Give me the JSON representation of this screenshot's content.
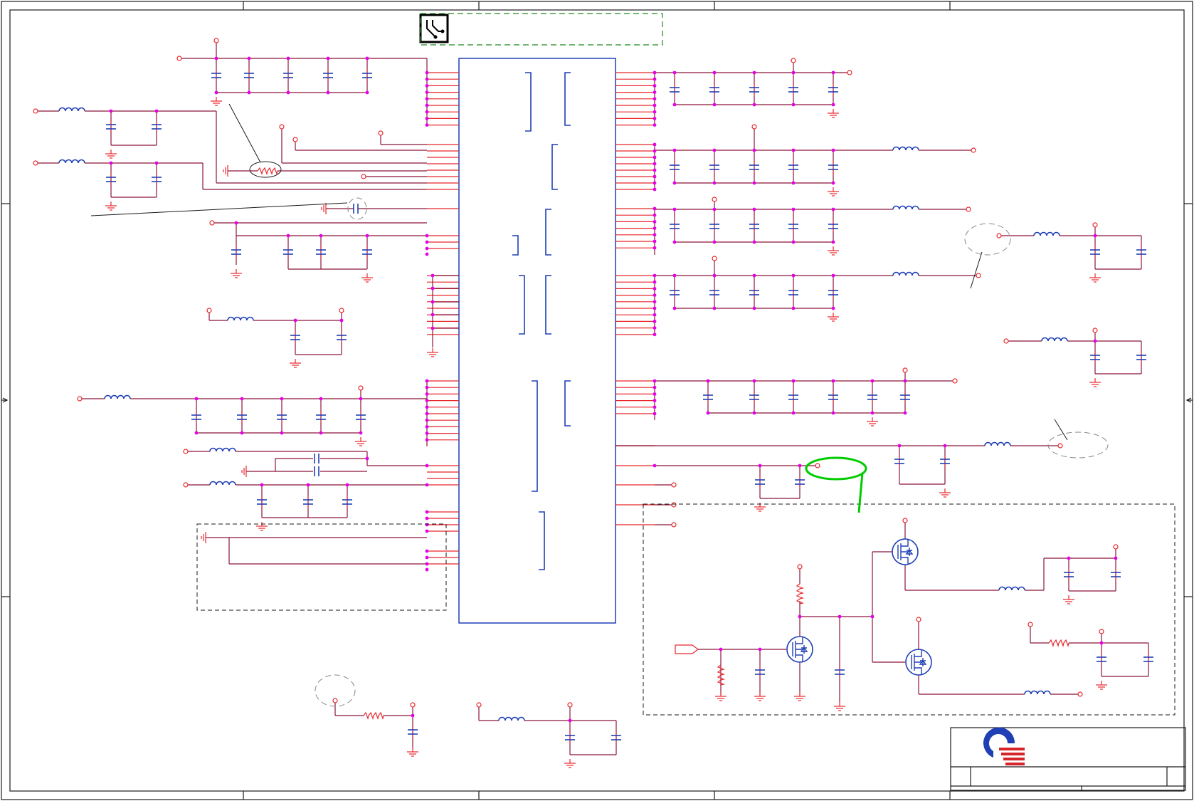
{
  "diagram": {
    "type": "schematic",
    "main_ic": {
      "ref": "",
      "part": "",
      "pin_labels": []
    },
    "note_box": {
      "text": ""
    },
    "highlight_note": {
      "text": ""
    },
    "callouts": [
      {
        "id": "callout-thermistor",
        "text": ""
      },
      {
        "id": "callout-capacitor",
        "text": ""
      },
      {
        "id": "callout-right-upper",
        "text": ""
      },
      {
        "id": "callout-right-lower",
        "text": ""
      },
      {
        "id": "callout-bottom-left",
        "text": ""
      }
    ],
    "net_labels": [],
    "title_block": {
      "company_logo": "quanta-logo",
      "title": "",
      "size": "",
      "document_number": "",
      "rev": "",
      "date": "",
      "sheet": ""
    }
  },
  "colors": {
    "wire": "#8b1538",
    "pin": "#e8262b",
    "component": "#1f3fb5",
    "junction": "#e600e6",
    "highlight": "#00cc00",
    "note_border": "#1e8a1e",
    "logo_blue": "#1f3fb5",
    "logo_red": "#d6262b"
  },
  "icons": [
    "pcb-icon",
    "quanta-logo",
    "mosfet-icon",
    "inductor-icon",
    "capacitor-icon",
    "resistor-icon",
    "ground-icon"
  ]
}
